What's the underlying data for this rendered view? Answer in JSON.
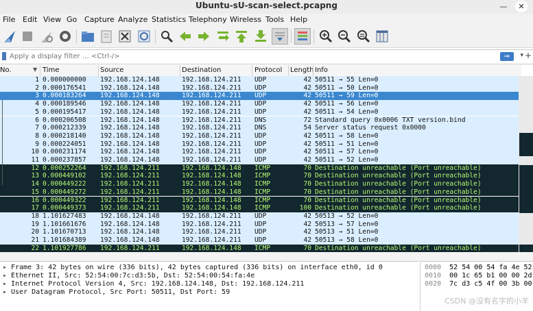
{
  "window": {
    "title": "Ubuntu-sU-scan-select.pcapng",
    "minimize": "—",
    "close": "✕"
  },
  "menu": [
    "File",
    "Edit",
    "View",
    "Go",
    "Capture",
    "Analyze",
    "Statistics",
    "Telephony",
    "Wireless",
    "Tools",
    "Help"
  ],
  "toolbar": {
    "icons": [
      "shark-fin-start-icon",
      "stop-capture-icon",
      "restart-capture-icon",
      "capture-options-icon",
      "open-file-icon",
      "save-file-icon",
      "close-file-icon",
      "reload-file-icon",
      "find-packet-icon",
      "go-back-icon",
      "go-forward-icon",
      "go-to-packet-icon",
      "go-first-icon",
      "go-last-icon",
      "auto-scroll-icon",
      "colorize-icon",
      "zoom-in-icon",
      "zoom-out-icon",
      "zoom-normal-icon",
      "resize-columns-icon"
    ]
  },
  "filter": {
    "placeholder": "Apply a display filter … <Ctrl-/>",
    "apply": "⇒",
    "dropdown": "▾",
    "add": "+"
  },
  "columns": {
    "no": "No.",
    "time": "Time",
    "source": "Source",
    "destination": "Destination",
    "protocol": "Protocol",
    "length": "Length",
    "info": "Info"
  },
  "packets": [
    {
      "no": "1",
      "time": "0.000000000",
      "src": "192.168.124.148",
      "dst": "192.168.124.211",
      "proto": "UDP",
      "len": "42",
      "info": "50511 → 55 Len=0",
      "style": "udp"
    },
    {
      "no": "2",
      "time": "0.000176541",
      "src": "192.168.124.148",
      "dst": "192.168.124.211",
      "proto": "UDP",
      "len": "42",
      "info": "50511 → 50 Len=0",
      "style": "udp"
    },
    {
      "no": "3",
      "time": "0.000183264",
      "src": "192.168.124.148",
      "dst": "192.168.124.211",
      "proto": "UDP",
      "len": "42",
      "info": "50511 → 59 Len=0",
      "style": "selected"
    },
    {
      "no": "4",
      "time": "0.000189546",
      "src": "192.168.124.148",
      "dst": "192.168.124.211",
      "proto": "UDP",
      "len": "42",
      "info": "50511 → 56 Len=0",
      "style": "udp"
    },
    {
      "no": "5",
      "time": "0.000195417",
      "src": "192.168.124.148",
      "dst": "192.168.124.211",
      "proto": "UDP",
      "len": "42",
      "info": "50511 → 54 Len=0",
      "style": "udp"
    },
    {
      "no": "6",
      "time": "0.000206508",
      "src": "192.168.124.148",
      "dst": "192.168.124.211",
      "proto": "DNS",
      "len": "72",
      "info": "Standard query 0x0006 TXT version.bind",
      "style": "dns"
    },
    {
      "no": "7",
      "time": "0.000212339",
      "src": "192.168.124.148",
      "dst": "192.168.124.211",
      "proto": "DNS",
      "len": "54",
      "info": "Server status request 0x0000",
      "style": "dns"
    },
    {
      "no": "8",
      "time": "0.000218140",
      "src": "192.168.124.148",
      "dst": "192.168.124.211",
      "proto": "UDP",
      "len": "42",
      "info": "50511 → 58 Len=0",
      "style": "udp"
    },
    {
      "no": "9",
      "time": "0.000224051",
      "src": "192.168.124.148",
      "dst": "192.168.124.211",
      "proto": "UDP",
      "len": "42",
      "info": "50511 → 51 Len=0",
      "style": "udp"
    },
    {
      "no": "10",
      "time": "0.000231174",
      "src": "192.168.124.148",
      "dst": "192.168.124.211",
      "proto": "UDP",
      "len": "42",
      "info": "50511 → 57 Len=0",
      "style": "udp"
    },
    {
      "no": "11",
      "time": "0.000237857",
      "src": "192.168.124.148",
      "dst": "192.168.124.211",
      "proto": "UDP",
      "len": "42",
      "info": "50511 → 52 Len=0",
      "style": "udp"
    },
    {
      "no": "12",
      "time": "0.000252264",
      "src": "192.168.124.211",
      "dst": "192.168.124.148",
      "proto": "ICMP",
      "len": "70",
      "info": "Destination unreachable (Port unreachable)",
      "style": "icmp"
    },
    {
      "no": "13",
      "time": "0.000449102",
      "src": "192.168.124.211",
      "dst": "192.168.124.148",
      "proto": "ICMP",
      "len": "70",
      "info": "Destination unreachable (Port unreachable)",
      "style": "icmp"
    },
    {
      "no": "14",
      "time": "0.000449222",
      "src": "192.168.124.211",
      "dst": "192.168.124.148",
      "proto": "ICMP",
      "len": "70",
      "info": "Destination unreachable (Port unreachable)",
      "style": "icmp"
    },
    {
      "no": "15",
      "time": "0.000449272",
      "src": "192.168.124.211",
      "dst": "192.168.124.148",
      "proto": "ICMP",
      "len": "70",
      "info": "Destination unreachable (Port unreachable)",
      "style": "icmp"
    },
    {
      "no": "16",
      "time": "0.000449322",
      "src": "192.168.124.211",
      "dst": "192.168.124.148",
      "proto": "ICMP",
      "len": "70",
      "info": "Destination unreachable (Port unreachable)",
      "style": "icmp"
    },
    {
      "no": "17",
      "time": "0.000449373",
      "src": "192.168.124.211",
      "dst": "192.168.124.148",
      "proto": "ICMP",
      "len": "100",
      "info": "Destination unreachable (Port unreachable)",
      "style": "icmp"
    },
    {
      "no": "18",
      "time": "1.101627483",
      "src": "192.168.124.148",
      "dst": "192.168.124.211",
      "proto": "UDP",
      "len": "42",
      "info": "50513 → 52 Len=0",
      "style": "udp"
    },
    {
      "no": "19",
      "time": "1.101661676",
      "src": "192.168.124.148",
      "dst": "192.168.124.211",
      "proto": "UDP",
      "len": "42",
      "info": "50513 → 57 Len=0",
      "style": "udp"
    },
    {
      "no": "20",
      "time": "1.101670713",
      "src": "192.168.124.148",
      "dst": "192.168.124.211",
      "proto": "UDP",
      "len": "42",
      "info": "50513 → 51 Len=0",
      "style": "udp"
    },
    {
      "no": "21",
      "time": "1.101684389",
      "src": "192.168.124.148",
      "dst": "192.168.124.211",
      "proto": "UDP",
      "len": "42",
      "info": "50513 → 58 Len=0",
      "style": "udp"
    },
    {
      "no": "22",
      "time": "1.101927786",
      "src": "192.168.124.211",
      "dst": "192.168.124.148",
      "proto": "ICMP",
      "len": "70",
      "info": "Destination unreachable (Port unreachable)",
      "style": "icmp"
    }
  ],
  "details": [
    "Frame 3: 42 bytes on wire (336 bits), 42 bytes captured (336 bits) on interface eth0, id 0",
    "Ethernet II, Src: 52:54:00:7c:d3:5b, Dst: 52:54:00:54:fa:4e",
    "Internet Protocol Version 4, Src: 192.168.124.148, Dst: 192.168.124.211",
    "User Datagram Protocol, Src Port: 50511, Dst Port: 59"
  ],
  "detail_arrow": "▸",
  "hex": [
    {
      "offset": "0000",
      "bytes": "52 54 00 54 fa 4e 52"
    },
    {
      "offset": "0010",
      "bytes": "00 1c 65 b1 00 00 2d"
    },
    {
      "offset": "0020",
      "bytes": "7c d3 c5 4f 00 3b 00"
    }
  ],
  "watermark": "CSDN @没有名字的小羊",
  "colors": {
    "udp_row": "#daeeff",
    "icmp_row": "#12272e",
    "icmp_text": "#b7f774",
    "selected_row": "#3a87cf"
  }
}
